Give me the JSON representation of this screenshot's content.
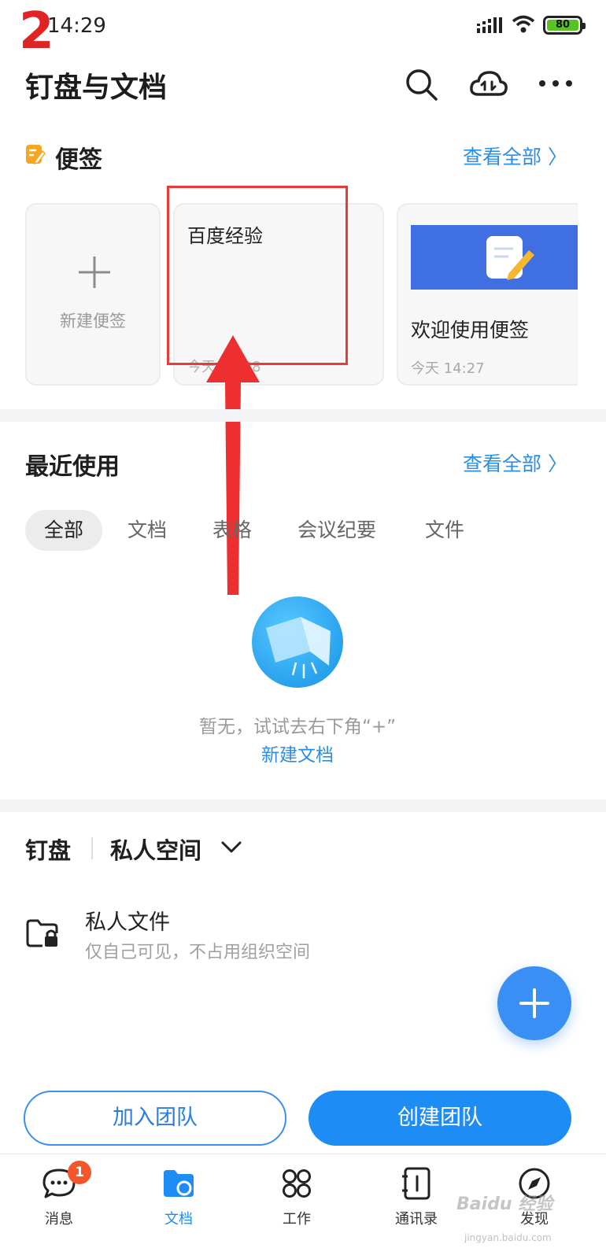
{
  "annotation": {
    "step_number": "2"
  },
  "status_bar": {
    "time": "14:29",
    "battery": "80"
  },
  "header": {
    "title": "钉盘与文档",
    "search_icon": "search-icon",
    "cloud_icon": "cloud-transfer-icon",
    "more_icon": "more-icon"
  },
  "notes": {
    "title": "便签",
    "see_all": "查看全部 〉",
    "new_label": "新建便签",
    "cards": [
      {
        "title": "百度经验",
        "date": "今天 14:28"
      },
      {
        "title": "欢迎使用便签",
        "date": "今天 14:27"
      }
    ]
  },
  "recent": {
    "title": "最近使用",
    "see_all": "查看全部 〉",
    "tabs": [
      "全部",
      "文档",
      "表格",
      "会议纪要",
      "文件"
    ],
    "empty_text": "暂无，试试去右下角“+”",
    "empty_link": "新建文档"
  },
  "drive": {
    "title": "钉盘",
    "space": "私人空间",
    "item_title": "私人文件",
    "item_sub": "仅自己可见，不占用组织空间"
  },
  "actions": {
    "join": "加入团队",
    "create": "创建团队"
  },
  "bottom_nav": {
    "items": [
      {
        "label": "消息",
        "icon": "chat-bubble-icon",
        "badge": "1"
      },
      {
        "label": "文档",
        "icon": "docs-folder-icon"
      },
      {
        "label": "工作",
        "icon": "apps-grid-icon"
      },
      {
        "label": "通讯录",
        "icon": "contacts-book-icon"
      },
      {
        "label": "发现",
        "icon": "compass-icon"
      }
    ]
  },
  "watermark": {
    "main": "Baidu 经验",
    "sub": "jingyan.baidu.com"
  },
  "colors": {
    "accent": "#1e8cf5",
    "link": "#2b8ee6",
    "annotation_red": "#e83a3a",
    "badge": "#f5552b"
  }
}
